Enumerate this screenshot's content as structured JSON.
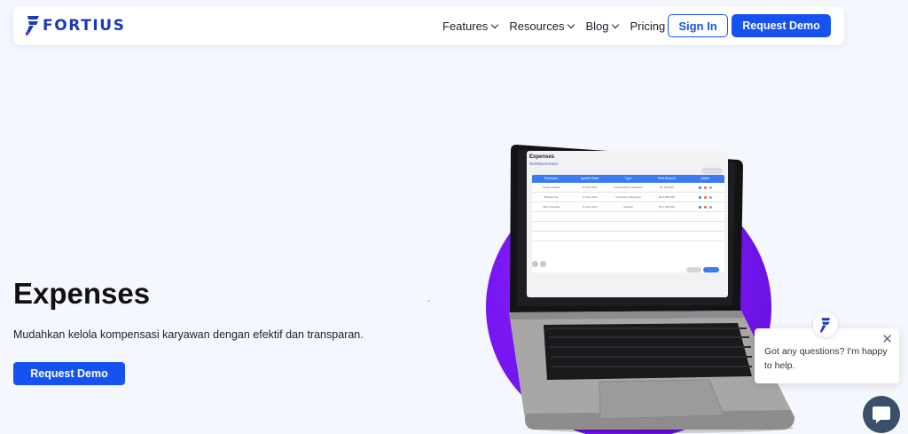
{
  "brand": {
    "name": "FORTIUS",
    "color": "#1b3bb5"
  },
  "nav": {
    "items": [
      {
        "label": "Features"
      },
      {
        "label": "Resources"
      },
      {
        "label": "Blog"
      },
      {
        "label": "Pricing"
      }
    ],
    "sign_in": "Sign In",
    "request_demo": "Request Demo"
  },
  "hero": {
    "title": "Expenses",
    "subtitle": "Mudahkan kelola kompensasi karyawan dengan efektif dan transparan.",
    "cta": "Request Demo"
  },
  "screen": {
    "title": "Expenses",
    "subtitle": "Reimbursement",
    "columns": [
      "Employee",
      "Applied Date",
      "Type",
      "Total Amount",
      "Action"
    ],
    "rows": [
      [
        "Sarah Isabelle",
        "20 Nov 2024",
        "Transportation Allowance",
        "Rp 500,000"
      ],
      [
        "Michael Tan",
        "17 Nov 2024",
        "Comissary Allowance",
        "Rp 2,500,000"
      ],
      [
        "Marini Rosalia",
        "15 Nov 2024",
        "Medical",
        "Rp 1,000,000"
      ]
    ]
  },
  "chat": {
    "message": "Got any questions? I'm happy to help."
  },
  "colors": {
    "accent": "#1652f0",
    "background": "#f4f7fd",
    "circle": "#7515f0",
    "chat_launcher": "#3a4f6a"
  },
  "icons": [
    "fortius-logo-icon",
    "chevron-down-icon",
    "close-icon",
    "chat-bubble-icon"
  ]
}
